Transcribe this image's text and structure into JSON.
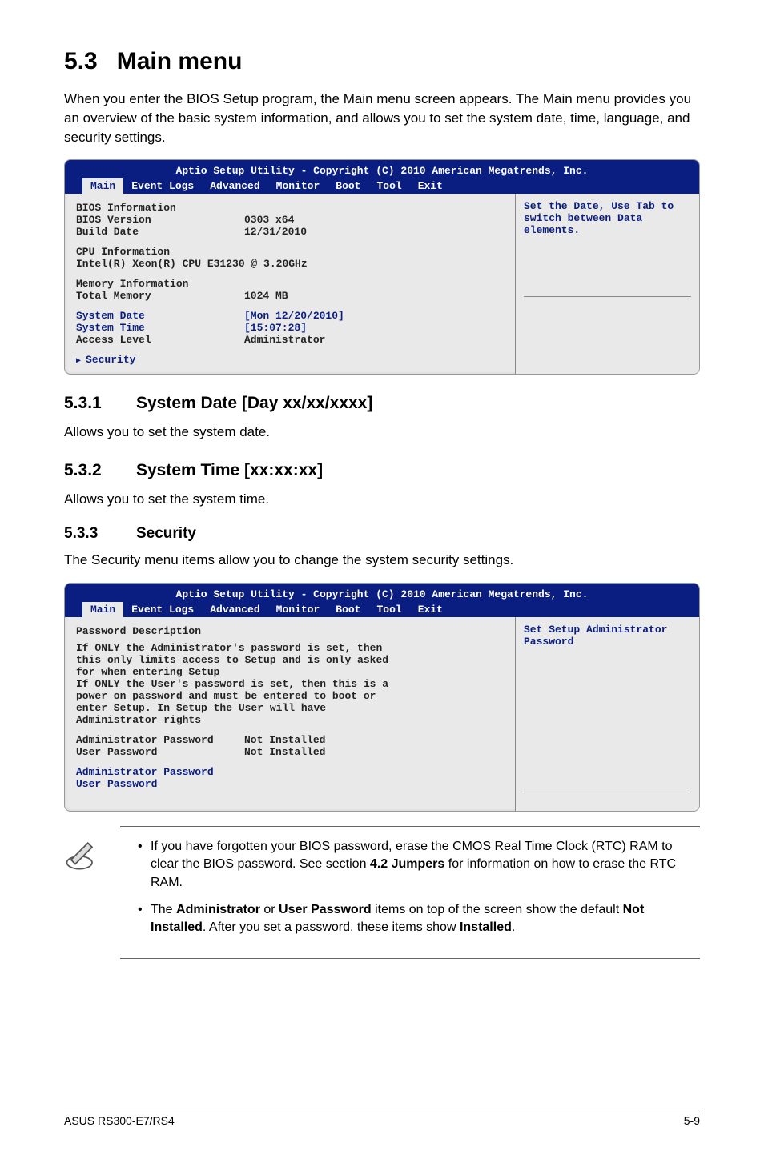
{
  "heading": {
    "number": "5.3",
    "title": "Main menu"
  },
  "intro": "When you enter the BIOS Setup program, the Main menu screen appears. The Main menu provides you an overview of the basic system information, and allows you to set the system date, time, language, and security settings.",
  "bios1": {
    "topline": "Aptio Setup Utility - Copyright (C) 2010 American Megatrends, Inc.",
    "tabs": [
      "Main",
      "Event Logs",
      "Advanced",
      "Monitor",
      "Boot",
      "Tool",
      "Exit"
    ],
    "help": "Set the Date, Use Tab to switch between Data elements.",
    "groups": {
      "g1_title": "BIOS Information",
      "g1_r1k": "BIOS Version",
      "g1_r1v": "0303 x64",
      "g1_r2k": "Build Date",
      "g1_r2v": "12/31/2010",
      "g2_title": "CPU Information",
      "g2_line": "Intel(R) Xeon(R) CPU E31230 @ 3.20GHz",
      "g3_title": "Memory Information",
      "g3_r1k": "Total Memory",
      "g3_r1v": "1024 MB",
      "g4_r1k": "System Date",
      "g4_r1v": "[Mon 12/20/2010]",
      "g4_r2k": "System Time",
      "g4_r2v": "[15:07:28]",
      "g4_r3k": "Access Level",
      "g4_r3v": "Administrator",
      "g5": "Security"
    }
  },
  "s1": {
    "num": "5.3.1",
    "title": "System Date [Day xx/xx/xxxx]",
    "body": "Allows you to set the system date."
  },
  "s2": {
    "num": "5.3.2",
    "title": "System Time [xx:xx:xx]",
    "body": "Allows you to set the system time."
  },
  "s3": {
    "num": "5.3.3",
    "title": "Security",
    "body": "The Security menu items allow you to change the system security settings."
  },
  "bios2": {
    "topline": "Aptio Setup Utility - Copyright (C) 2010 American Megatrends, Inc.",
    "tabs": [
      "Main",
      "Event Logs",
      "Advanced",
      "Monitor",
      "Boot",
      "Tool",
      "Exit"
    ],
    "help": "Set Setup Administrator Password",
    "pd_title": "Password Description",
    "pd_body": "If ONLY the Administrator's password is set, then this only limits access to Setup and is only asked for when entering Setup\nIf ONLY the User's password is set, then this is a power on password and must be entered to boot or enter Setup. In Setup the User will have Administrator rights",
    "r1k": "Administrator Password",
    "r1v": "Not Installed",
    "r2k": "User Password",
    "r2v": "Not Installed",
    "l1": "Administrator Password",
    "l2": "User Password"
  },
  "notes": {
    "n1a": "If you have forgotten your BIOS password, erase the CMOS Real Time Clock (RTC) RAM to clear the BIOS password. See section ",
    "n1b": "4.2 Jumpers",
    "n1c": " for information on how to erase the RTC RAM.",
    "n2a": "The ",
    "n2b": "Administrator",
    "n2c": " or ",
    "n2d": "User Password",
    "n2e": " items on top of the screen show the default ",
    "n2f": "Not Installed",
    "n2g": ". After you set a password, these items show ",
    "n2h": "Installed",
    "n2i": "."
  },
  "footer": {
    "left": "ASUS RS300-E7/RS4",
    "right": "5-9"
  }
}
